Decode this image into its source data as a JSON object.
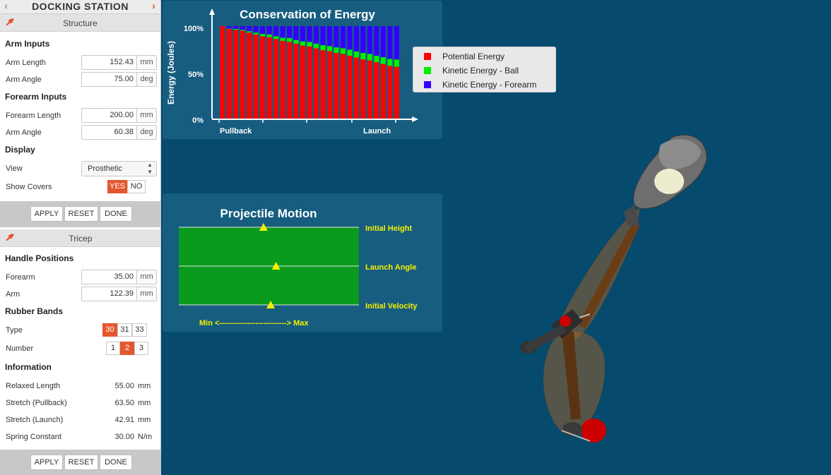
{
  "header": {
    "title": "DOCKING STATION",
    "prev_icon": "chevron-left-icon",
    "next_icon": "chevron-right-icon",
    "accent": "#e4572e"
  },
  "structure": {
    "title": "Structure",
    "arm_inputs": {
      "heading": "Arm Inputs",
      "arm_length": {
        "label": "Arm Length",
        "value": "152.43",
        "unit": "mm"
      },
      "arm_angle": {
        "label": "Arm Angle",
        "value": "75.00",
        "unit": "deg"
      }
    },
    "forearm_inputs": {
      "heading": "Forearm Inputs",
      "forearm_length": {
        "label": "Forearm Length",
        "value": "200.00",
        "unit": "mm"
      },
      "arm_angle": {
        "label": "Arm Angle",
        "value": "60.38",
        "unit": "deg"
      }
    },
    "display": {
      "heading": "Display",
      "view": {
        "label": "View",
        "selected": "Prosthetic"
      },
      "show_covers": {
        "label": "Show Covers",
        "yes": "YES",
        "no": "NO",
        "selected": "YES"
      }
    },
    "buttons": {
      "apply": "APPLY",
      "reset": "RESET",
      "done": "DONE"
    }
  },
  "tricep": {
    "title": "Tricep",
    "handle_positions": {
      "heading": "Handle Positions",
      "forearm": {
        "label": "Forearm",
        "value": "35.00",
        "unit": "mm"
      },
      "arm": {
        "label": "Arm",
        "value": "122.39",
        "unit": "mm"
      }
    },
    "rubber_bands": {
      "heading": "Rubber Bands",
      "type": {
        "label": "Type",
        "options": [
          "30",
          "31",
          "33"
        ],
        "selected": "30"
      },
      "number": {
        "label": "Number",
        "options": [
          "1",
          "2",
          "3"
        ],
        "selected": "2"
      }
    },
    "information": {
      "heading": "Information",
      "rows": [
        {
          "label": "Relaxed Length",
          "value": "55.00",
          "unit": "mm"
        },
        {
          "label": "Stretch (Pullback)",
          "value": "63.50",
          "unit": "mm"
        },
        {
          "label": "Stretch (Launch)",
          "value": "42.91",
          "unit": "mm"
        },
        {
          "label": "Spring Constant",
          "value": "30.00",
          "unit": "N/m"
        }
      ]
    },
    "buttons": {
      "apply": "APPLY",
      "reset": "RESET",
      "done": "DONE"
    }
  },
  "projectile": {
    "title": "Projectile Motion",
    "sliders": [
      {
        "label": "Initial Height",
        "fraction": 0.47
      },
      {
        "label": "Launch Angle",
        "fraction": 0.54
      },
      {
        "label": "Initial Velocity",
        "fraction": 0.51
      }
    ],
    "range_label": "Min <--------------------------> Max"
  },
  "legend": [
    {
      "name": "Potential Energy",
      "color": "#ff0000"
    },
    {
      "name": "Kinetic Energy - Ball",
      "color": "#00ee00"
    },
    {
      "name": "Kinetic Energy - Forearm",
      "color": "#3300ff"
    }
  ],
  "chart_data": {
    "type": "bar",
    "stacked": true,
    "title": "Conservation of Energy",
    "ylabel": "Energy (Joules)",
    "ylim": [
      0,
      100
    ],
    "yticks": [
      "0%",
      "50%",
      "100%"
    ],
    "x_tick_labels": [
      "Pullback",
      "Launch"
    ],
    "series": [
      {
        "name": "Potential Energy",
        "color": "#ff0000",
        "values": [
          100,
          97,
          96,
          95,
          93,
          91,
          89,
          88,
          86,
          84,
          83,
          81,
          79,
          78,
          76,
          74,
          73,
          71,
          70,
          68,
          66,
          64,
          63,
          61,
          59,
          57,
          56
        ]
      },
      {
        "name": "Kinetic Energy - Ball",
        "color": "#00ee00",
        "values": [
          0,
          0.5,
          1,
          1,
          1.5,
          2,
          2.5,
          3,
          3,
          3.5,
          4,
          4,
          4.5,
          5,
          5,
          5.5,
          5.5,
          6,
          6,
          6.5,
          6.5,
          7,
          7,
          7,
          7.5,
          7.5,
          8
        ]
      },
      {
        "name": "Kinetic Energy - Forearm",
        "color": "#3300ff",
        "values": [
          0,
          2.5,
          3,
          4,
          5.5,
          7,
          8.5,
          9,
          11,
          12.5,
          13,
          15,
          16.5,
          17,
          19,
          20.5,
          21.5,
          23,
          24,
          25.5,
          27.5,
          29,
          30,
          32,
          33.5,
          35.5,
          36
        ]
      }
    ]
  }
}
